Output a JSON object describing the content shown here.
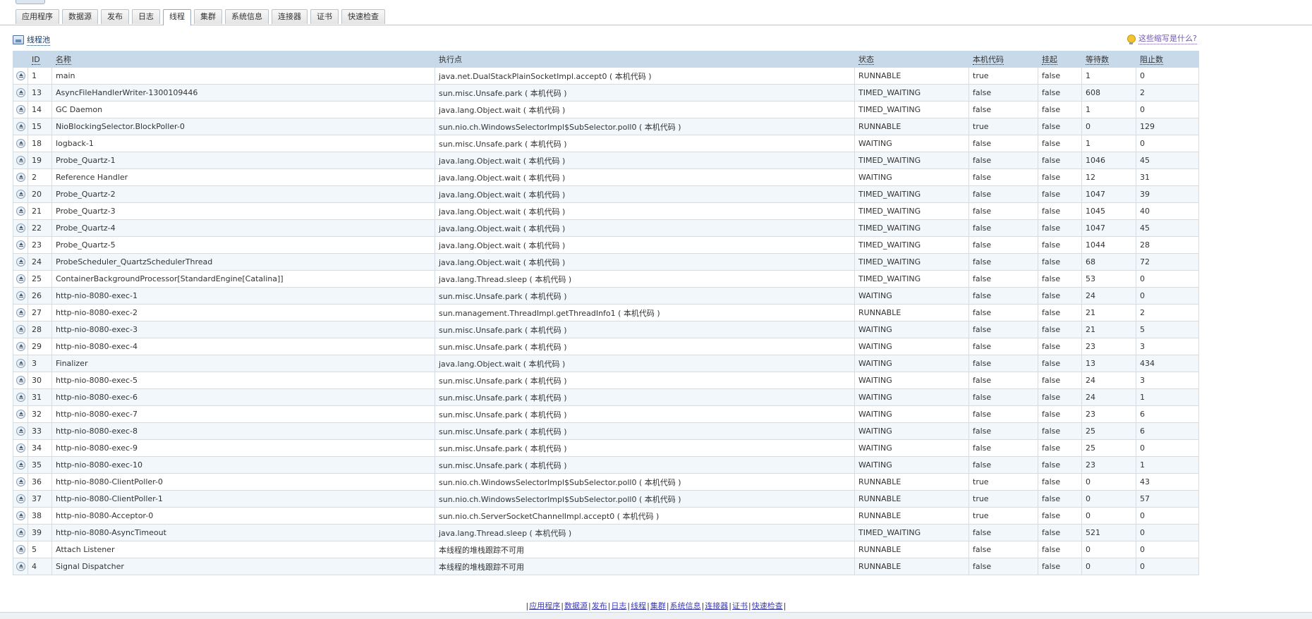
{
  "tabs": [
    {
      "label": "应用程序",
      "active": false
    },
    {
      "label": "数据源",
      "active": false
    },
    {
      "label": "发布",
      "active": false
    },
    {
      "label": "日志",
      "active": false
    },
    {
      "label": "线程",
      "active": true
    },
    {
      "label": "集群",
      "active": false
    },
    {
      "label": "系统信息",
      "active": false
    },
    {
      "label": "连接器",
      "active": false
    },
    {
      "label": "证书",
      "active": false
    },
    {
      "label": "快速检查",
      "active": false
    }
  ],
  "header": {
    "pool_link": "线程池",
    "help_link": "这些缩写是什么?"
  },
  "table": {
    "columns": [
      "ID",
      "名称",
      "执行点",
      "状态",
      "本机代码",
      "挂起",
      "等待数",
      "阻止数"
    ],
    "rows": [
      [
        "1",
        "main",
        "java.net.DualStackPlainSocketImpl.accept0 ( 本机代码 )",
        "RUNNABLE",
        "true",
        "false",
        "1",
        "0"
      ],
      [
        "13",
        "AsyncFileHandlerWriter-1300109446",
        "sun.misc.Unsafe.park ( 本机代码 )",
        "TIMED_WAITING",
        "false",
        "false",
        "608",
        "2"
      ],
      [
        "14",
        "GC Daemon",
        "java.lang.Object.wait ( 本机代码 )",
        "TIMED_WAITING",
        "false",
        "false",
        "1",
        "0"
      ],
      [
        "15",
        "NioBlockingSelector.BlockPoller-0",
        "sun.nio.ch.WindowsSelectorImpl$SubSelector.poll0 ( 本机代码 )",
        "RUNNABLE",
        "true",
        "false",
        "0",
        "129"
      ],
      [
        "18",
        "logback-1",
        "sun.misc.Unsafe.park ( 本机代码 )",
        "WAITING",
        "false",
        "false",
        "1",
        "0"
      ],
      [
        "19",
        "Probe_Quartz-1",
        "java.lang.Object.wait ( 本机代码 )",
        "TIMED_WAITING",
        "false",
        "false",
        "1046",
        "45"
      ],
      [
        "2",
        "Reference Handler",
        "java.lang.Object.wait ( 本机代码 )",
        "WAITING",
        "false",
        "false",
        "12",
        "31"
      ],
      [
        "20",
        "Probe_Quartz-2",
        "java.lang.Object.wait ( 本机代码 )",
        "TIMED_WAITING",
        "false",
        "false",
        "1047",
        "39"
      ],
      [
        "21",
        "Probe_Quartz-3",
        "java.lang.Object.wait ( 本机代码 )",
        "TIMED_WAITING",
        "false",
        "false",
        "1045",
        "40"
      ],
      [
        "22",
        "Probe_Quartz-4",
        "java.lang.Object.wait ( 本机代码 )",
        "TIMED_WAITING",
        "false",
        "false",
        "1047",
        "45"
      ],
      [
        "23",
        "Probe_Quartz-5",
        "java.lang.Object.wait ( 本机代码 )",
        "TIMED_WAITING",
        "false",
        "false",
        "1044",
        "28"
      ],
      [
        "24",
        "ProbeScheduler_QuartzSchedulerThread",
        "java.lang.Object.wait ( 本机代码 )",
        "TIMED_WAITING",
        "false",
        "false",
        "68",
        "72"
      ],
      [
        "25",
        "ContainerBackgroundProcessor[StandardEngine[Catalina]]",
        "java.lang.Thread.sleep ( 本机代码 )",
        "TIMED_WAITING",
        "false",
        "false",
        "53",
        "0"
      ],
      [
        "26",
        "http-nio-8080-exec-1",
        "sun.misc.Unsafe.park ( 本机代码 )",
        "WAITING",
        "false",
        "false",
        "24",
        "0"
      ],
      [
        "27",
        "http-nio-8080-exec-2",
        "sun.management.ThreadImpl.getThreadInfo1 ( 本机代码 )",
        "RUNNABLE",
        "false",
        "false",
        "21",
        "2"
      ],
      [
        "28",
        "http-nio-8080-exec-3",
        "sun.misc.Unsafe.park ( 本机代码 )",
        "WAITING",
        "false",
        "false",
        "21",
        "5"
      ],
      [
        "29",
        "http-nio-8080-exec-4",
        "sun.misc.Unsafe.park ( 本机代码 )",
        "WAITING",
        "false",
        "false",
        "23",
        "3"
      ],
      [
        "3",
        "Finalizer",
        "java.lang.Object.wait ( 本机代码 )",
        "WAITING",
        "false",
        "false",
        "13",
        "434"
      ],
      [
        "30",
        "http-nio-8080-exec-5",
        "sun.misc.Unsafe.park ( 本机代码 )",
        "WAITING",
        "false",
        "false",
        "24",
        "3"
      ],
      [
        "31",
        "http-nio-8080-exec-6",
        "sun.misc.Unsafe.park ( 本机代码 )",
        "WAITING",
        "false",
        "false",
        "24",
        "1"
      ],
      [
        "32",
        "http-nio-8080-exec-7",
        "sun.misc.Unsafe.park ( 本机代码 )",
        "WAITING",
        "false",
        "false",
        "23",
        "6"
      ],
      [
        "33",
        "http-nio-8080-exec-8",
        "sun.misc.Unsafe.park ( 本机代码 )",
        "WAITING",
        "false",
        "false",
        "25",
        "6"
      ],
      [
        "34",
        "http-nio-8080-exec-9",
        "sun.misc.Unsafe.park ( 本机代码 )",
        "WAITING",
        "false",
        "false",
        "25",
        "0"
      ],
      [
        "35",
        "http-nio-8080-exec-10",
        "sun.misc.Unsafe.park ( 本机代码 )",
        "WAITING",
        "false",
        "false",
        "23",
        "1"
      ],
      [
        "36",
        "http-nio-8080-ClientPoller-0",
        "sun.nio.ch.WindowsSelectorImpl$SubSelector.poll0 ( 本机代码 )",
        "RUNNABLE",
        "true",
        "false",
        "0",
        "43"
      ],
      [
        "37",
        "http-nio-8080-ClientPoller-1",
        "sun.nio.ch.WindowsSelectorImpl$SubSelector.poll0 ( 本机代码 )",
        "RUNNABLE",
        "true",
        "false",
        "0",
        "57"
      ],
      [
        "38",
        "http-nio-8080-Acceptor-0",
        "sun.nio.ch.ServerSocketChannelImpl.accept0 ( 本机代码 )",
        "RUNNABLE",
        "true",
        "false",
        "0",
        "0"
      ],
      [
        "39",
        "http-nio-8080-AsyncTimeout",
        "java.lang.Thread.sleep ( 本机代码 )",
        "TIMED_WAITING",
        "false",
        "false",
        "521",
        "0"
      ],
      [
        "5",
        "Attach Listener",
        "本线程的堆栈跟踪不可用",
        "RUNNABLE",
        "false",
        "false",
        "0",
        "0"
      ],
      [
        "4",
        "Signal Dispatcher",
        "本线程的堆栈跟踪不可用",
        "RUNNABLE",
        "false",
        "false",
        "0",
        "0"
      ]
    ]
  },
  "footer": {
    "links": [
      "应用程序",
      "数据源",
      "发布",
      "日志",
      "线程",
      "集群",
      "系统信息",
      "连接器",
      "证书",
      "快速检查"
    ]
  },
  "colors": {
    "header_bg": "#c8d9ea",
    "row_alt": "#f2f7fb",
    "link": "#3a3ab5"
  }
}
